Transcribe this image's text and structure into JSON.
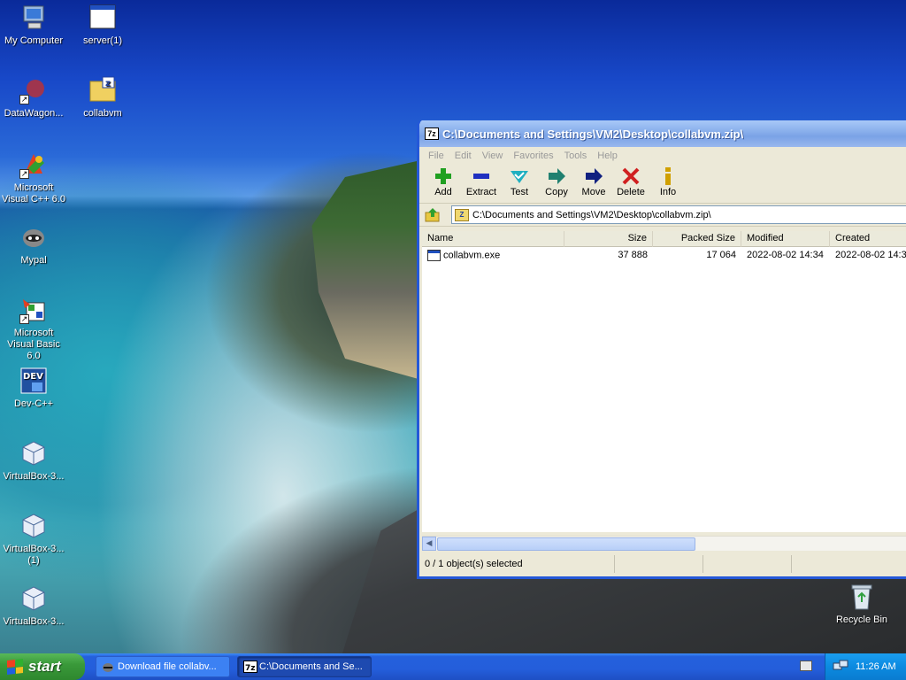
{
  "desktop": {
    "icons": [
      {
        "label": "My Computer",
        "icon": "my-computer-icon"
      },
      {
        "label": "server(1)",
        "icon": "window-app-icon"
      },
      {
        "label": "DataWagon...",
        "icon": "datawagon-icon"
      },
      {
        "label": "collabvm",
        "icon": "zip-folder-icon"
      },
      {
        "label": "Microsoft Visual C++ 6.0",
        "icon": "visual-cpp-icon"
      },
      {
        "label": "Mypal",
        "icon": "mypal-raccoon-icon"
      },
      {
        "label": "Microsoft Visual Basic 6.0",
        "icon": "visual-basic-icon"
      },
      {
        "label": "Dev-C++",
        "icon": "devcpp-icon"
      },
      {
        "label": "VirtualBox-3...",
        "icon": "virtualbox-cube-icon"
      },
      {
        "label": "VirtualBox-3... (1)",
        "icon": "virtualbox-cube-icon"
      },
      {
        "label": "VirtualBox-3...",
        "icon": "virtualbox-cube-icon"
      },
      {
        "label": "Recycle Bin",
        "icon": "recycle-bin-icon"
      }
    ]
  },
  "window": {
    "title": "C:\\Documents and Settings\\VM2\\Desktop\\collabvm.zip\\",
    "app_icon": "7z",
    "menu": [
      "File",
      "Edit",
      "View",
      "Favorites",
      "Tools",
      "Help"
    ],
    "toolbar": [
      {
        "label": "Add",
        "icon": "add-plus-icon",
        "color": "#20a020"
      },
      {
        "label": "Extract",
        "icon": "extract-minus-icon",
        "color": "#2030c0"
      },
      {
        "label": "Test",
        "icon": "test-check-icon",
        "color": "#20b0c0"
      },
      {
        "label": "Copy",
        "icon": "copy-arrow-icon",
        "color": "#208070"
      },
      {
        "label": "Move",
        "icon": "move-arrow-icon",
        "color": "#102080"
      },
      {
        "label": "Delete",
        "icon": "delete-x-icon",
        "color": "#d02020"
      },
      {
        "label": "Info",
        "icon": "info-i-icon",
        "color": "#d0a000"
      }
    ],
    "address": "C:\\Documents and Settings\\VM2\\Desktop\\collabvm.zip\\",
    "columns": [
      "Name",
      "Size",
      "Packed Size",
      "Modified",
      "Created"
    ],
    "rows": [
      {
        "name": "collabvm.exe",
        "size": "37 888",
        "packed": "17 064",
        "modified": "2022-08-02 14:34",
        "created": "2022-08-02 14:3"
      }
    ],
    "status": "0 / 1 object(s) selected"
  },
  "taskbar": {
    "start_label": "start",
    "tasks": [
      {
        "label": "Download file collabv...",
        "icon": "download-raccoon-icon",
        "active": false
      },
      {
        "label": "C:\\Documents and Se...",
        "icon": "7z-app-icon",
        "active": true
      }
    ],
    "clock": "11:26 AM"
  }
}
